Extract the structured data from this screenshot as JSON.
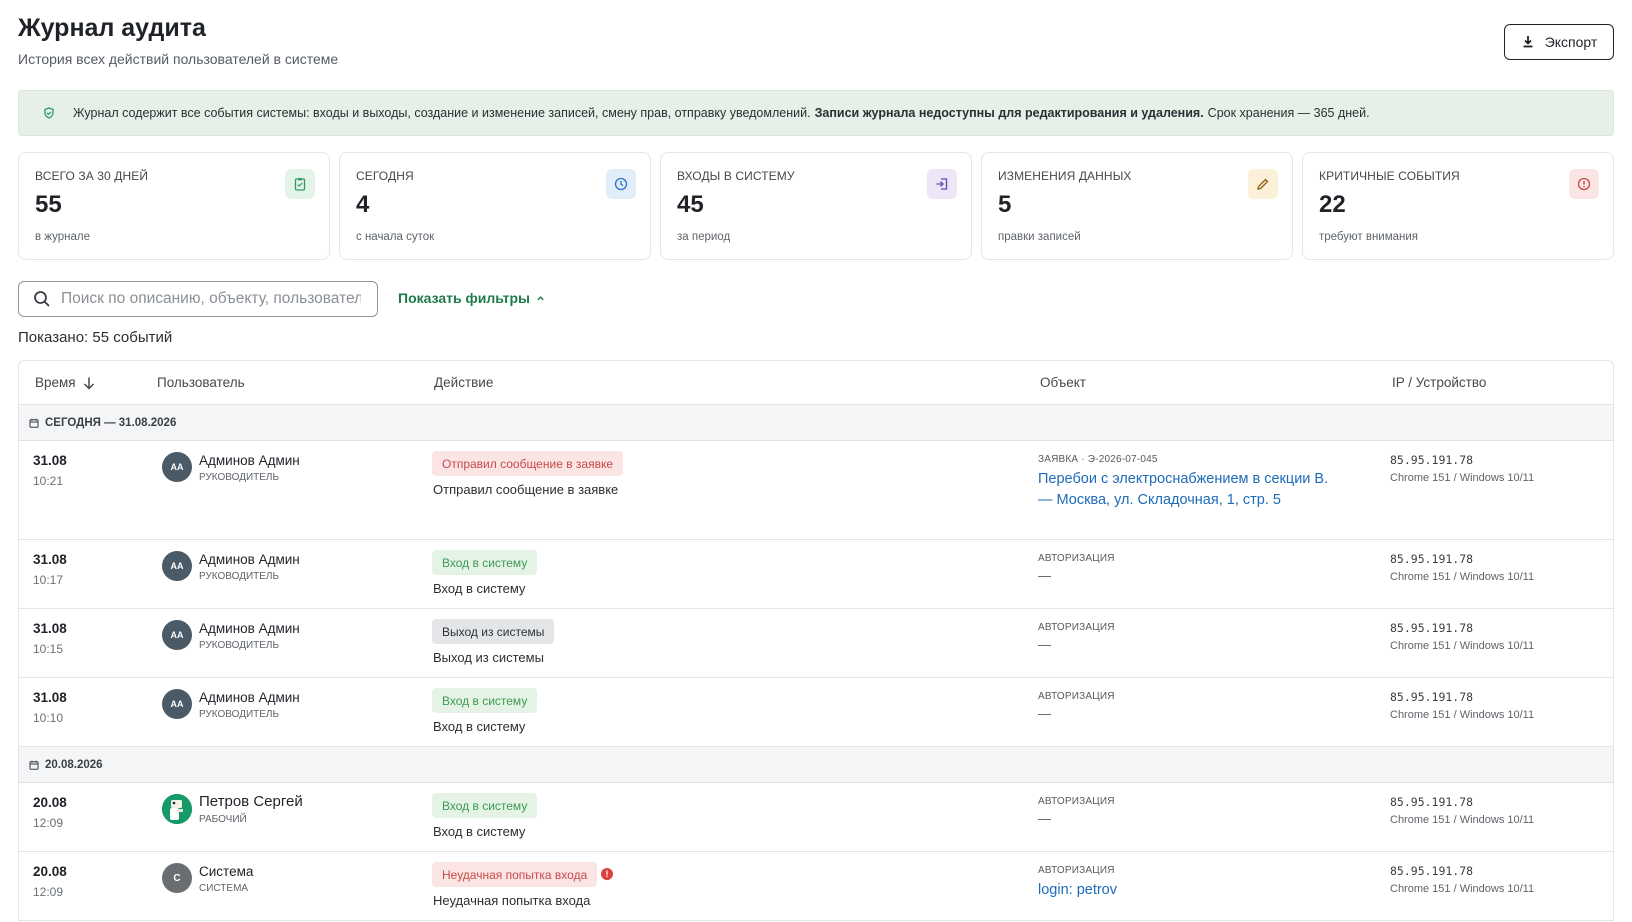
{
  "header": {
    "title": "Журнал аудита",
    "subtitle": "История всех действий пользователей в системе",
    "export_label": "Экспорт"
  },
  "notice": {
    "text_before": "Журнал содержит все события системы: входы и выходы, создание и изменение записей, смену прав, отправку уведомлений.",
    "text_bold": "Записи журнала недоступны для редактирования и удаления.",
    "text_after": "Срок хранения — 365 дней."
  },
  "stats": [
    {
      "label": "Всего за 30 дней",
      "value": "55",
      "sub": "в журнале",
      "icon": "clipboard-icon",
      "color": "#2f9a64",
      "bg": "#e4f3ea"
    },
    {
      "label": "Сегодня",
      "value": "4",
      "sub": "с начала суток",
      "icon": "clock-icon",
      "color": "#2f73c4",
      "bg": "#e1edf9"
    },
    {
      "label": "Входы в систему",
      "value": "45",
      "sub": "за период",
      "icon": "login-icon",
      "color": "#6a47b8",
      "bg": "#ece6f7"
    },
    {
      "label": "Изменения данных",
      "value": "5",
      "sub": "правки записей",
      "icon": "pencil-icon",
      "color": "#b07a10",
      "bg": "#fbf0d8"
    },
    {
      "label": "Критичные события",
      "value": "22",
      "sub": "требуют внимания",
      "icon": "alert-icon",
      "color": "#c84a4a",
      "bg": "#fbe4e4"
    }
  ],
  "search": {
    "placeholder": "Поиск по описанию, объекту, пользователю"
  },
  "filters_toggle": "Показать фильтры",
  "shown_count": "Показано: 55 событий",
  "table": {
    "headers": {
      "time": "Время",
      "user": "Пользователь",
      "action": "Действие",
      "object": "Объект",
      "ip": "IP / Устройство"
    },
    "groups": [
      {
        "label": "Сегодня — 31.08.2026",
        "rows": [
          {
            "date": "31.08",
            "time": "10:21",
            "avatar": "АА",
            "user": "Админов Админ",
            "role": "Руководитель",
            "badge": "Отправил сообщение в заявке",
            "badge_color": "red",
            "desc": "Отправил сообщение в заявке",
            "obj_type": "Заявка · Э-2026-07-045",
            "obj_link": "Перебои с электроснабжением в секции В. — Москва, ул. Складочная, 1, стр. 5",
            "ip": "85.95.191.78",
            "device": "Chrome 151 / Windows 10/11"
          },
          {
            "date": "31.08",
            "time": "10:17",
            "avatar": "АА",
            "user": "Админов Админ",
            "role": "Руководитель",
            "badge": "Вход в систему",
            "badge_color": "green",
            "desc": "Вход в систему",
            "obj_type": "Авторизация",
            "obj_dash": "—",
            "ip": "85.95.191.78",
            "device": "Chrome 151 / Windows 10/11"
          },
          {
            "date": "31.08",
            "time": "10:15",
            "avatar": "АА",
            "user": "Админов Админ",
            "role": "Руководитель",
            "badge": "Выход из системы",
            "badge_color": "gray",
            "desc": "Выход из системы",
            "obj_type": "Авторизация",
            "obj_dash": "—",
            "ip": "85.95.191.78",
            "device": "Chrome 151 / Windows 10/11"
          },
          {
            "date": "31.08",
            "time": "10:10",
            "avatar": "АА",
            "user": "Админов Админ",
            "role": "Руководитель",
            "badge": "Вход в систему",
            "badge_color": "green",
            "desc": "Вход в систему",
            "obj_type": "Авторизация",
            "obj_dash": "—",
            "ip": "85.95.191.78",
            "device": "Chrome 151 / Windows 10/11"
          }
        ]
      },
      {
        "label": "20.08.2026",
        "rows": [
          {
            "date": "20.08",
            "time": "12:09",
            "avatar": "",
            "user": "Петров Сергей",
            "role": "Рабочий",
            "badge": "Вход в систему",
            "badge_color": "green",
            "desc": "Вход в систему",
            "obj_type": "Авторизация",
            "obj_dash": "—",
            "ip": "85.95.191.78",
            "device": "Chrome 151 / Windows 10/11"
          },
          {
            "date": "20.08",
            "time": "12:09",
            "avatar": "С",
            "user": "Система",
            "role": "Система",
            "badge": "Неудачная попытка входа",
            "badge_color": "red",
            "alert": "!",
            "desc": "Неудачная попытка входа",
            "obj_type": "Авторизация",
            "obj_link": "login: petrov",
            "ip": "85.95.191.78",
            "device": "Chrome 151 / Windows 10/11"
          }
        ]
      }
    ]
  }
}
